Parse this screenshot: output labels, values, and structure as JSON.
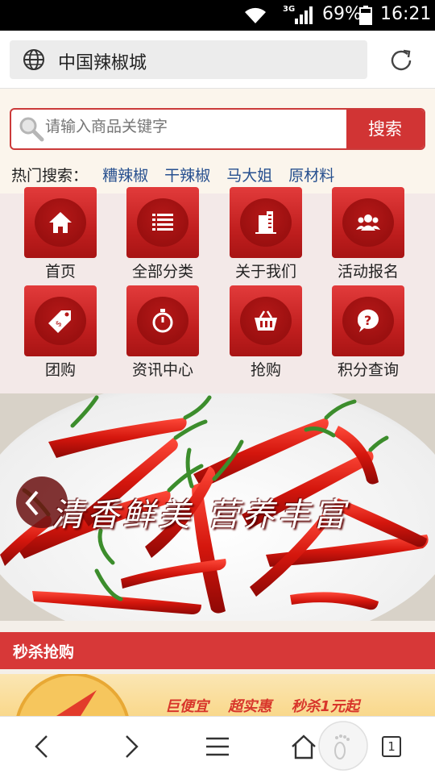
{
  "status_bar": {
    "network": "3G",
    "battery": "69%",
    "time": "16:21"
  },
  "browser": {
    "address": "中国辣椒城",
    "tabs_count": "1"
  },
  "search": {
    "placeholder": "请输入商品关键字",
    "button": "搜索"
  },
  "hot": {
    "label": "热门搜索：",
    "items": [
      "糟辣椒",
      "干辣椒",
      "马大姐",
      "原材料"
    ]
  },
  "menu": [
    {
      "label": "首页",
      "icon": "home-icon"
    },
    {
      "label": "全部分类",
      "icon": "list-icon"
    },
    {
      "label": "关于我们",
      "icon": "building-icon"
    },
    {
      "label": "活动报名",
      "icon": "people-icon"
    },
    {
      "label": "团购",
      "icon": "tag-icon"
    },
    {
      "label": "资讯中心",
      "icon": "stopwatch-icon"
    },
    {
      "label": "抢购",
      "icon": "basket-icon"
    },
    {
      "label": "积分查询",
      "icon": "question-icon"
    }
  ],
  "banner": {
    "slogan": "清香鲜美  营养丰富"
  },
  "flash_sale": {
    "title": "秒杀抢购",
    "promo": [
      "巨便宜",
      "超实惠",
      "秒杀1元起"
    ]
  },
  "colors": {
    "brand_red": "#d13434",
    "link_blue": "#27508f",
    "promo_red": "#d8362b"
  }
}
